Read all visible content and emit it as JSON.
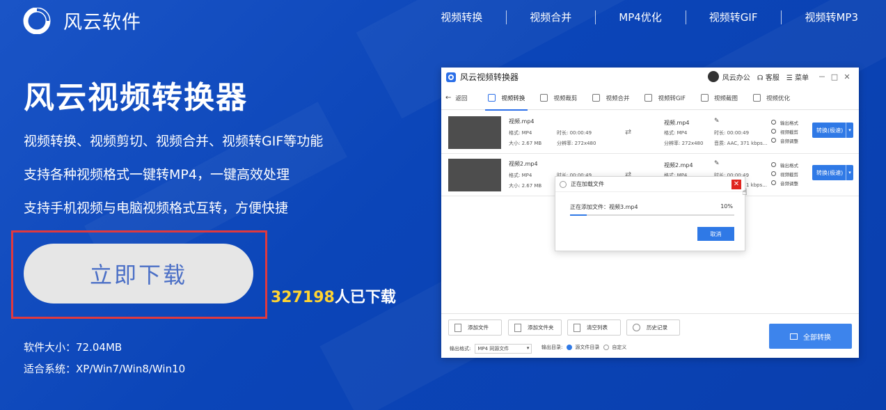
{
  "header": {
    "brand": "风云软件",
    "nav": [
      "视频转换",
      "视频合并",
      "MP4优化",
      "视频转GIF",
      "视频转MP3"
    ]
  },
  "hero": {
    "title": "风云视频转换器",
    "features": [
      "视频转换、视频剪切、视频合并、视频转GIF等功能",
      "支持各种视频格式一键转MP4，一键高效处理",
      "支持手机视频与电脑视频格式互转，方便快捷"
    ],
    "download_label": "立即下载",
    "download_count": "327198",
    "download_suffix": "人已下载",
    "size": "软件大小：72.04MB",
    "system": "适合系统：XP/Win7/Win8/Win10"
  },
  "app": {
    "title": "风云视频转换器",
    "user": "风云办公",
    "service": "客服",
    "menu": "菜单",
    "window_controls": [
      "－",
      "□",
      "✕"
    ],
    "back": "返回",
    "tools": [
      "视频转换",
      "视频裁剪",
      "视频合并",
      "视频转GIF",
      "视频截图",
      "视频优化"
    ],
    "files": [
      {
        "name": "视频.mp4",
        "format": "格式: MP4",
        "size": "大小: 2.67 MB",
        "duration": "时长: 00:00:49",
        "resolution": "分辨率: 272x480",
        "out_name": "视频.mp4",
        "out_format": "格式: MP4",
        "out_resolution": "分辨率: 272x480",
        "out_duration": "时长: 00:00:49",
        "out_audio": "音质: AAC, 371 kbps..."
      },
      {
        "name": "视频2.mp4",
        "format": "格式: MP4",
        "size": "大小: 2.67 MB",
        "duration": "时长: 00:00:49",
        "resolution": "",
        "out_name": "视频2.mp4",
        "out_format": "格式: MP4",
        "out_resolution": "",
        "out_duration": "时长: 00:00:49",
        "out_audio": "1 kbps..."
      }
    ],
    "ops": [
      "输出格式",
      "视频截剪",
      "音频调整"
    ],
    "convert_label": "转换(极速)",
    "dialog": {
      "title": "正在加载文件",
      "message": "正在添加文件：视频3.mp4",
      "percent": "10%",
      "progress": 0.1,
      "cancel": "取消"
    },
    "bottom": {
      "add_file": "添加文件",
      "add_folder": "添加文件夹",
      "clear_list": "清空列表",
      "history": "历史记录",
      "output_format_label": "输出格式:",
      "output_format_value": "MP4 同源文件",
      "output_dir_label": "输出目录:",
      "source_dir": "源文件目录",
      "custom": "自定义",
      "convert_all": "全部转换"
    }
  }
}
